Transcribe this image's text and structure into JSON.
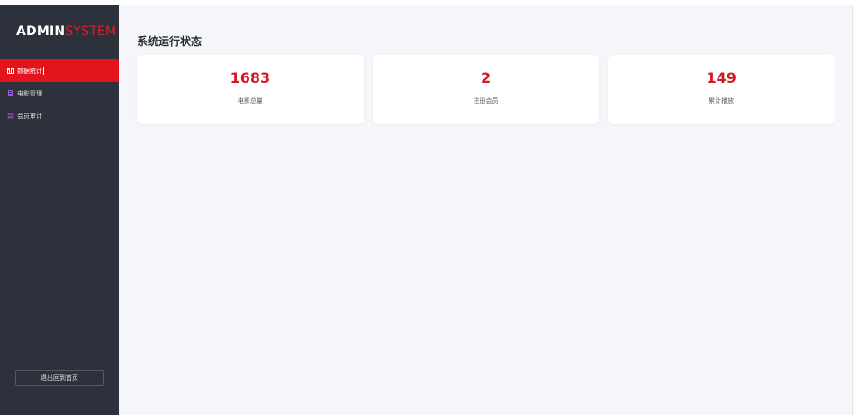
{
  "brand": {
    "part1": "ADMIN",
    "part2": "SYSTEM",
    "accent_color": "#e21c25"
  },
  "sidebar": {
    "items": [
      {
        "label": "数据统计",
        "icon": "bar-chart-icon",
        "active": true
      },
      {
        "label": "电影管理",
        "icon": "film-icon",
        "active": false
      },
      {
        "label": "会员审计",
        "icon": "users-icon",
        "active": false
      }
    ],
    "logout_label": "退出回到首页"
  },
  "main": {
    "title": "系统运行状态",
    "stats": [
      {
        "value": "1683",
        "label": "电影总量"
      },
      {
        "value": "2",
        "label": "注册会员"
      },
      {
        "value": "149",
        "label": "累计播放"
      }
    ]
  }
}
